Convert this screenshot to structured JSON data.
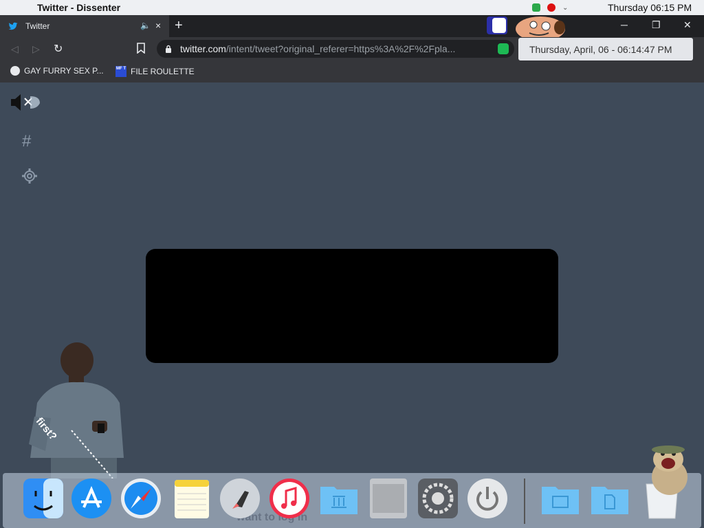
{
  "menubar": {
    "apple_glyph": "",
    "app_title": "Twitter - Dissenter",
    "clock": "Thursday 06:15 PM"
  },
  "tab": {
    "label": "Twitter",
    "mute_glyph": "🔈",
    "close_glyph": "×"
  },
  "tabstrip": {
    "new_tab_glyph": "+",
    "minimize_glyph": "─",
    "restore_glyph": "❐",
    "close_glyph": "✕"
  },
  "toolbar": {
    "back_glyph": "◁",
    "forward_glyph": "▷",
    "reload_glyph": "↻",
    "url_host": "twitter.com",
    "url_path": "/intent/tweet?original_referer=https%3A%2F%2Fpla..."
  },
  "tooltip": {
    "text": "Thursday, April, 06 - 06:14:47 PM"
  },
  "bookmarks": [
    {
      "label": "GAY FURRY SEX P...",
      "icon": "globe-icon"
    },
    {
      "label": "FILE ROULETTE",
      "icon": "mft-icon",
      "badge": "MF T"
    }
  ],
  "sidebar": {
    "hash_glyph": "#"
  },
  "overlay": {
    "caption": "first?"
  },
  "dock": {
    "ghost_text": "want to log in",
    "items": [
      "finder-icon",
      "app-store-icon",
      "safari-icon",
      "notes-icon",
      "launchpad-icon",
      "itunes-icon",
      "library-folder-icon",
      "mac-pro-icon",
      "system-preferences-icon",
      "power-icon",
      "applications-folder-icon",
      "documents-folder-icon",
      "trash-icon"
    ]
  },
  "colors": {
    "page_bg": "#3e4a59",
    "browser_dark": "#35363a",
    "twitter_blue": "#1da1f2"
  }
}
